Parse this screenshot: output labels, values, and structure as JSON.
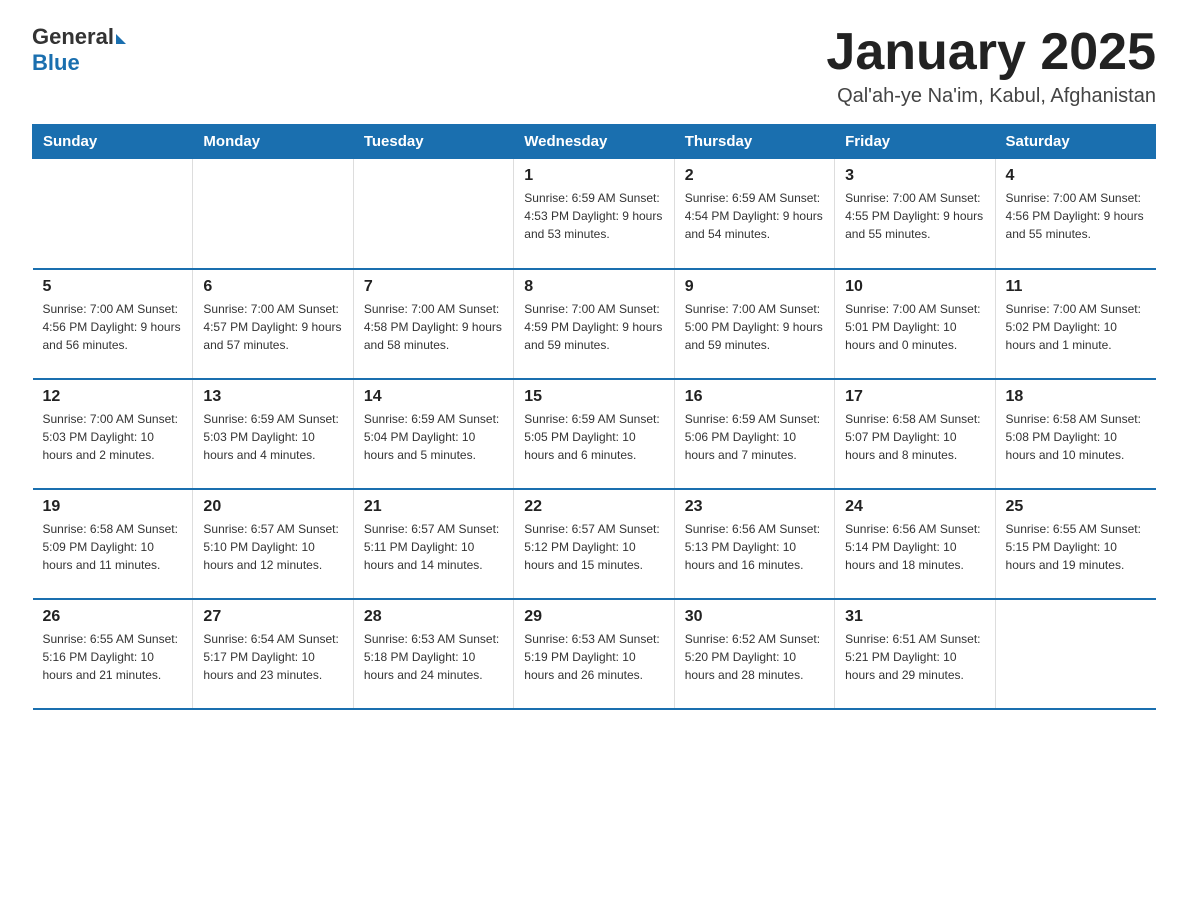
{
  "logo": {
    "general": "General",
    "blue": "Blue"
  },
  "title": {
    "month_year": "January 2025",
    "location": "Qal'ah-ye Na'im, Kabul, Afghanistan"
  },
  "days_of_week": [
    "Sunday",
    "Monday",
    "Tuesday",
    "Wednesday",
    "Thursday",
    "Friday",
    "Saturday"
  ],
  "weeks": [
    [
      {
        "day": "",
        "info": ""
      },
      {
        "day": "",
        "info": ""
      },
      {
        "day": "",
        "info": ""
      },
      {
        "day": "1",
        "info": "Sunrise: 6:59 AM\nSunset: 4:53 PM\nDaylight: 9 hours and 53 minutes."
      },
      {
        "day": "2",
        "info": "Sunrise: 6:59 AM\nSunset: 4:54 PM\nDaylight: 9 hours and 54 minutes."
      },
      {
        "day": "3",
        "info": "Sunrise: 7:00 AM\nSunset: 4:55 PM\nDaylight: 9 hours and 55 minutes."
      },
      {
        "day": "4",
        "info": "Sunrise: 7:00 AM\nSunset: 4:56 PM\nDaylight: 9 hours and 55 minutes."
      }
    ],
    [
      {
        "day": "5",
        "info": "Sunrise: 7:00 AM\nSunset: 4:56 PM\nDaylight: 9 hours and 56 minutes."
      },
      {
        "day": "6",
        "info": "Sunrise: 7:00 AM\nSunset: 4:57 PM\nDaylight: 9 hours and 57 minutes."
      },
      {
        "day": "7",
        "info": "Sunrise: 7:00 AM\nSunset: 4:58 PM\nDaylight: 9 hours and 58 minutes."
      },
      {
        "day": "8",
        "info": "Sunrise: 7:00 AM\nSunset: 4:59 PM\nDaylight: 9 hours and 59 minutes."
      },
      {
        "day": "9",
        "info": "Sunrise: 7:00 AM\nSunset: 5:00 PM\nDaylight: 9 hours and 59 minutes."
      },
      {
        "day": "10",
        "info": "Sunrise: 7:00 AM\nSunset: 5:01 PM\nDaylight: 10 hours and 0 minutes."
      },
      {
        "day": "11",
        "info": "Sunrise: 7:00 AM\nSunset: 5:02 PM\nDaylight: 10 hours and 1 minute."
      }
    ],
    [
      {
        "day": "12",
        "info": "Sunrise: 7:00 AM\nSunset: 5:03 PM\nDaylight: 10 hours and 2 minutes."
      },
      {
        "day": "13",
        "info": "Sunrise: 6:59 AM\nSunset: 5:03 PM\nDaylight: 10 hours and 4 minutes."
      },
      {
        "day": "14",
        "info": "Sunrise: 6:59 AM\nSunset: 5:04 PM\nDaylight: 10 hours and 5 minutes."
      },
      {
        "day": "15",
        "info": "Sunrise: 6:59 AM\nSunset: 5:05 PM\nDaylight: 10 hours and 6 minutes."
      },
      {
        "day": "16",
        "info": "Sunrise: 6:59 AM\nSunset: 5:06 PM\nDaylight: 10 hours and 7 minutes."
      },
      {
        "day": "17",
        "info": "Sunrise: 6:58 AM\nSunset: 5:07 PM\nDaylight: 10 hours and 8 minutes."
      },
      {
        "day": "18",
        "info": "Sunrise: 6:58 AM\nSunset: 5:08 PM\nDaylight: 10 hours and 10 minutes."
      }
    ],
    [
      {
        "day": "19",
        "info": "Sunrise: 6:58 AM\nSunset: 5:09 PM\nDaylight: 10 hours and 11 minutes."
      },
      {
        "day": "20",
        "info": "Sunrise: 6:57 AM\nSunset: 5:10 PM\nDaylight: 10 hours and 12 minutes."
      },
      {
        "day": "21",
        "info": "Sunrise: 6:57 AM\nSunset: 5:11 PM\nDaylight: 10 hours and 14 minutes."
      },
      {
        "day": "22",
        "info": "Sunrise: 6:57 AM\nSunset: 5:12 PM\nDaylight: 10 hours and 15 minutes."
      },
      {
        "day": "23",
        "info": "Sunrise: 6:56 AM\nSunset: 5:13 PM\nDaylight: 10 hours and 16 minutes."
      },
      {
        "day": "24",
        "info": "Sunrise: 6:56 AM\nSunset: 5:14 PM\nDaylight: 10 hours and 18 minutes."
      },
      {
        "day": "25",
        "info": "Sunrise: 6:55 AM\nSunset: 5:15 PM\nDaylight: 10 hours and 19 minutes."
      }
    ],
    [
      {
        "day": "26",
        "info": "Sunrise: 6:55 AM\nSunset: 5:16 PM\nDaylight: 10 hours and 21 minutes."
      },
      {
        "day": "27",
        "info": "Sunrise: 6:54 AM\nSunset: 5:17 PM\nDaylight: 10 hours and 23 minutes."
      },
      {
        "day": "28",
        "info": "Sunrise: 6:53 AM\nSunset: 5:18 PM\nDaylight: 10 hours and 24 minutes."
      },
      {
        "day": "29",
        "info": "Sunrise: 6:53 AM\nSunset: 5:19 PM\nDaylight: 10 hours and 26 minutes."
      },
      {
        "day": "30",
        "info": "Sunrise: 6:52 AM\nSunset: 5:20 PM\nDaylight: 10 hours and 28 minutes."
      },
      {
        "day": "31",
        "info": "Sunrise: 6:51 AM\nSunset: 5:21 PM\nDaylight: 10 hours and 29 minutes."
      },
      {
        "day": "",
        "info": ""
      }
    ]
  ]
}
